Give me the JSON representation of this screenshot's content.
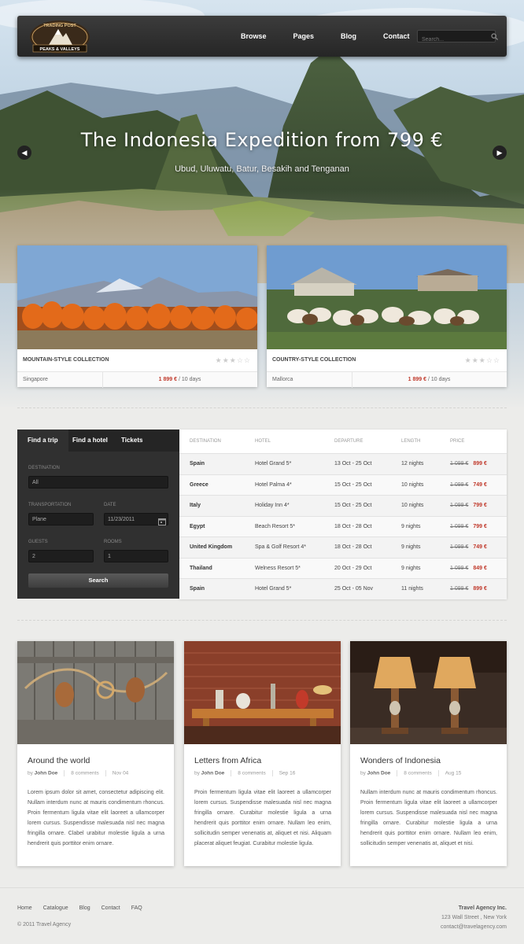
{
  "header": {
    "logo_top": "TRADING POST",
    "logo_bottom": "PEAKS & VALLEYS",
    "nav": [
      "Browse",
      "Pages",
      "Blog",
      "Contact"
    ],
    "search_placeholder": "Search..."
  },
  "hero": {
    "title": "The Indonesia Expedition from 799 €",
    "subtitle": "Ubud, Uluwatu, Batur, Besakih and Tenganan",
    "prev_glyph": "◀",
    "next_glyph": "▶"
  },
  "featured": [
    {
      "title": "MOUNTAIN-STYLE COLLECTION",
      "location": "Singapore",
      "price": "1 899 €",
      "duration": " / 10 days",
      "stars": "★★★☆☆"
    },
    {
      "title": "COUNTRY-STYLE COLLECTION",
      "location": "Mallorca",
      "price": "1 899 €",
      "duration": " / 10 days",
      "stars": "★★★☆☆"
    }
  ],
  "search_panel": {
    "tabs": [
      "Find a trip",
      "Find a hotel",
      "Tickets"
    ],
    "destination_label": "DESTINATION",
    "destination_value": "All",
    "transportation_label": "TRANSPORTATION",
    "transportation_value": "Plane",
    "date_label": "DATE",
    "date_value": "11/23/2011",
    "guests_label": "GUESTS",
    "guests_value": "2",
    "rooms_label": "ROOMS",
    "rooms_value": "1",
    "button": "Search"
  },
  "table": {
    "headers": [
      "DESTINATION",
      "HOTEL",
      "DEPARTURE",
      "LENGTH",
      "PRICE"
    ],
    "rows": [
      {
        "destination": "Spain",
        "hotel": "Hotel Grand 5*",
        "departure": "13 Oct - 25 Oct",
        "length": "12 nights",
        "old_price": "1 099 €",
        "price": "899 €"
      },
      {
        "destination": "Greece",
        "hotel": "Hotel Palma 4*",
        "departure": "15 Oct - 25 Oct",
        "length": "10 nights",
        "old_price": "1 099 €",
        "price": "749 €"
      },
      {
        "destination": "Italy",
        "hotel": "Holiday Inn 4*",
        "departure": "15 Oct - 25 Oct",
        "length": "10 nights",
        "old_price": "1 099 €",
        "price": "799 €"
      },
      {
        "destination": "Egypt",
        "hotel": "Beach Resort 5*",
        "departure": "18 Oct - 28 Oct",
        "length": "9 nights",
        "old_price": "1 099 €",
        "price": "799 €"
      },
      {
        "destination": "United Kingdom",
        "hotel": "Spa & Golf Resort 4*",
        "departure": "18 Oct - 28 Oct",
        "length": "9 nights",
        "old_price": "1 099 €",
        "price": "749 €"
      },
      {
        "destination": "Thailand",
        "hotel": "Welness Resort 5*",
        "departure": "20 Oct - 29 Oct",
        "length": "9 nights",
        "old_price": "1 099 €",
        "price": "849 €"
      },
      {
        "destination": "Spain",
        "hotel": "Hotel Grand 5*",
        "departure": "25 Oct - 05 Nov",
        "length": "11 nights",
        "old_price": "1 099 €",
        "price": "899 €"
      }
    ]
  },
  "posts": [
    {
      "title": "Around the world",
      "by": "by ",
      "author": "John Doe",
      "comments": "8 comments",
      "date": "Nov 04",
      "text": "Lorem ipsum dolor sit amet, consectetur adipiscing elit. Nullam interdum nunc at mauris condimentum rhoncus. Proin fermentum ligula vitae elit laoreet a ullamcorper lorem cursus. Suspendisse malesuada nisl nec magna fringilla ornare. Clabel urabitur molestie ligula a urna hendrerit quis porttitor enim ornare."
    },
    {
      "title": "Letters from Africa",
      "by": "by ",
      "author": "John Doe",
      "comments": "8 comments",
      "date": "Sep 16",
      "text": "Proin fermentum ligula vitae elit laoreet a ullamcorper lorem cursus. Suspendisse malesuada nisl nec magna fringilla ornare. Curabitur molestie ligula a urna hendrerit quis porttitor enim ornare. Nullam leo enim, sollicitudin semper venenatis at, aliquet et nisi. Aliquam placerat aliquet feugiat. Curabitur molestie ligula."
    },
    {
      "title": "Wonders of Indonesia",
      "by": "by ",
      "author": "John Doe",
      "comments": "8 comments",
      "date": "Aug 15",
      "text": "Nullam interdum nunc at mauris condimentum rhoncus. Proin fermentum ligula vitae elit laoreet a ullamcorper lorem cursus. Suspendisse malesuada nisl nec magna fringilla ornare. Curabitur molestie ligula a urna hendrerit quis porttitor enim ornare. Nullam leo enim, sollicitudin semper venenatis at, aliquet et nisi."
    }
  ],
  "footer": {
    "nav": [
      "Home",
      "Catalogue",
      "Blog",
      "Contact",
      "FAQ"
    ],
    "copyright": "© 2011 Travel Agency",
    "company": "Travel Agency Inc.",
    "address": "123 Wall Street , New York",
    "email": "contact@travelagency.com"
  },
  "colors": {
    "accent_price": "#c0392b",
    "dark_panel": "#303030",
    "topbar": "#2e2e2e"
  }
}
